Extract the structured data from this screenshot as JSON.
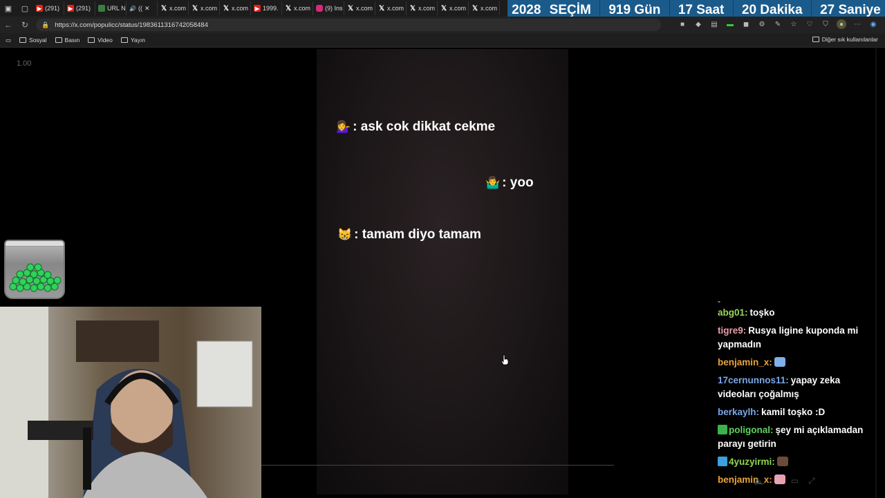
{
  "tabs": [
    {
      "icon": "youtube",
      "label": "(291)"
    },
    {
      "icon": "youtube",
      "label": "(291)"
    },
    {
      "icon": "generic",
      "label": "URL N"
    },
    {
      "icon": "audio",
      "label": "(("
    },
    {
      "icon": "x",
      "label": "x.com"
    },
    {
      "icon": "x",
      "label": "x.com"
    },
    {
      "icon": "x",
      "label": "x.com"
    },
    {
      "icon": "youtube",
      "label": "1999."
    },
    {
      "icon": "x",
      "label": "x.com"
    },
    {
      "icon": "instagram",
      "label": "(9) Ins"
    },
    {
      "icon": "x",
      "label": "x.com"
    },
    {
      "icon": "x",
      "label": "x.com"
    },
    {
      "icon": "x",
      "label": "x.com"
    },
    {
      "icon": "x",
      "label": "x.com"
    },
    {
      "icon": "x",
      "label": "x.com"
    }
  ],
  "banner": {
    "year": "2028",
    "event": "SEÇİM",
    "days": "919 Gün",
    "hours": "17 Saat",
    "minutes": "20 Dakika",
    "seconds": "27 Saniye"
  },
  "address": {
    "url": "https://x.com/populicc/status/1983611316742058484"
  },
  "bookmarks": {
    "items": [
      "Sosyal",
      "Basın",
      "Video",
      "Yayın"
    ],
    "other": "Diğer sık kullanılanlar"
  },
  "overlay": {
    "scale": "1.00"
  },
  "video": {
    "lines": [
      {
        "emoji": "💁‍♀️",
        "text": ": ask cok dikkat cekme"
      },
      {
        "emoji": "🤷‍♂️",
        "text": ": yoo"
      },
      {
        "emoji": "😸",
        "text": ": tamam diyo tamam"
      }
    ]
  },
  "chat": {
    "messages": [
      {
        "user": "abg01:",
        "text": "toşko",
        "color": "#9ad65a"
      },
      {
        "user": "tigre9:",
        "text": "Rusya ligine kuponda mi yapmadın",
        "color": "#e8a0a8"
      },
      {
        "user": "benjamin_x:",
        "text": "",
        "color": "#e8a33c"
      },
      {
        "user": "17cernunnos11:",
        "text": "yapay zeka videoları çoğalmış",
        "color": "#7aa7e6"
      },
      {
        "user": "berkaylh:",
        "text": "kamil toşko :D",
        "color": "#7aa7e6"
      },
      {
        "user": "poligonal:",
        "text": "şey mi açıklamadan parayı getirin",
        "color": "#5fd35f"
      },
      {
        "user": "4yuzyirmi:",
        "text": "",
        "color": "#8fd64f"
      },
      {
        "user": "benjamin_x:",
        "text": "",
        "color": "#e8a33c"
      }
    ]
  },
  "colors": {
    "banner_bg": "#1b5b8c",
    "page_bg": "#000000"
  }
}
